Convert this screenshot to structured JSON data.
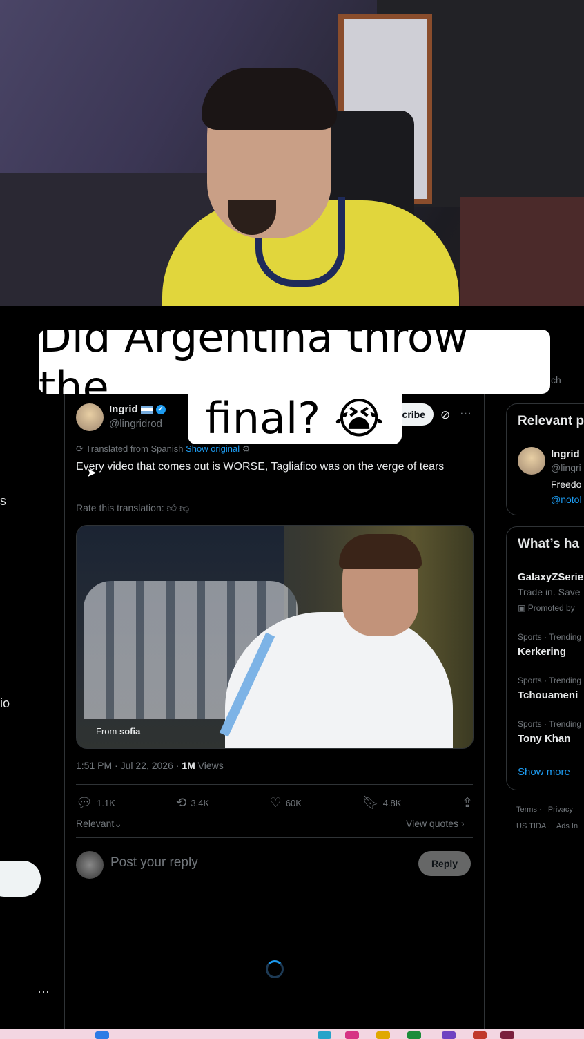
{
  "caption": {
    "line1": "Did Argentina throw the",
    "line2": "final? 😭"
  },
  "left_nav": {
    "frag_s": "s",
    "frag_io": "io",
    "more": "···"
  },
  "tweet": {
    "author_name": "Ingrid",
    "author_handle": "@lingridrod",
    "subscribe_label": "cribe",
    "translated_label": "Translated from Spanish",
    "show_original": "Show original",
    "text": "Every video that comes out is WORSE, Tagliafico was on the verge of tears",
    "rate_label": "Rate this translation:",
    "media_from": "From",
    "media_source": "sofia",
    "time": "1:51 PM · Jul 22, 2026 ·",
    "views_count": "1M",
    "views_label": "Views",
    "replies": "1.1K",
    "reposts": "3.4K",
    "likes": "60K",
    "bookmarks": "4.8K",
    "sort_label": "Relevant",
    "view_quotes": "View quotes",
    "reply_placeholder": "Post your reply",
    "reply_button": "Reply"
  },
  "right": {
    "search_frag": "ch",
    "relevant_title": "Relevant p",
    "rel_name": "Ingrid",
    "rel_handle": "@lingri",
    "rel_text": "Freedo",
    "rel_link": "@notol",
    "trending_title": "What’s ha",
    "promo_title": "GalaxyZSerie",
    "promo_text": "Trade in. Save",
    "promo_label": "Promoted by",
    "trends": [
      {
        "category": "Sports · Trending",
        "name": "Kerkering"
      },
      {
        "category": "Sports · Trending",
        "name": "Tchouameni"
      },
      {
        "category": "Sports · Trending",
        "name": "Tony Khan"
      }
    ],
    "show_more": "Show more",
    "footer": {
      "terms": "Terms",
      "privacy": "Privacy",
      "ustida": "US TIDA",
      "ads": "Ads In"
    }
  },
  "colors": {
    "accent": "#1d9bf0",
    "background": "#000000",
    "text": "#e7e9ea",
    "muted": "#71767b",
    "caption_bg": "#ffffff"
  }
}
